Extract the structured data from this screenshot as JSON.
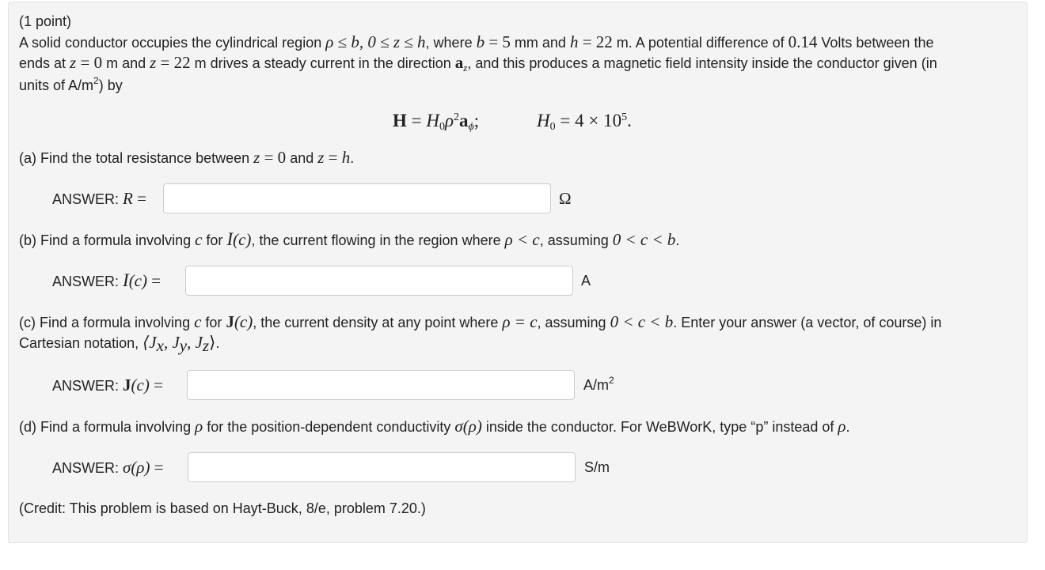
{
  "problem": {
    "points": "(1 point)",
    "intro": {
      "l1_a": "A solid conductor occupies the cylindrical region ",
      "l1_m1": "ρ ≤ b, 0 ≤ z ≤ h",
      "l1_b": ", where ",
      "l1_m2": "b",
      "l1_eq1": " = 5",
      "l1_c": " mm and ",
      "l1_m3": "h",
      "l1_eq2": " = 22",
      "l1_d": " m. A potential difference of ",
      "l1_m4": "0.14",
      "l1_e": " Volts between the",
      "l2_a": "ends at ",
      "l2_m1": "z",
      "l2_eq1": " = 0",
      "l2_b": " m and ",
      "l2_m2": "z",
      "l2_eq2": " = 22",
      "l2_c": " m drives a steady current in the direction ",
      "l2_vec": "a",
      "l2_vec_sub": "z",
      "l2_d": ", and this produces a magnetic field intensity inside the conductor given (in",
      "l3_a": "units of A/m",
      "l3_sup": "2",
      "l3_b": ") by"
    },
    "equation": {
      "H_bold": "H",
      "eq_sign": " = ",
      "H0": "H",
      "H0_sub": "0",
      "rho": "ρ",
      "rho_sup": "2",
      "a_bold": "a",
      "a_sub": "ϕ",
      "semicolon": ";",
      "H0b": "H",
      "H0b_sub": "0",
      "rhs": " = 4 × 10",
      "rhs_sup": "5",
      "period": "."
    },
    "parts": [
      {
        "id": "a",
        "question_text_1": "(a) Find the total resistance between ",
        "question_math_1": "z",
        "question_eq_1": " = 0",
        "question_text_2": " and ",
        "question_math_2": "z",
        "question_eq_2": " = ",
        "question_math_3": "h",
        "question_text_3": ".",
        "answer_label": "ANSWER: ",
        "answer_math": "R",
        "answer_eq": " =",
        "input_value": "",
        "unit": "Ω"
      },
      {
        "id": "b",
        "question_text_1": "(b) Find a formula involving ",
        "question_math_1": "c",
        "question_text_2": " for ",
        "question_math_2": "I",
        "question_math_2b": "(c)",
        "question_text_3": ", the current flowing in the region where ",
        "question_math_3": "ρ < c",
        "question_text_4": ", assuming ",
        "question_math_4": "0 < c < b",
        "question_text_5": ".",
        "answer_label": "ANSWER: ",
        "answer_math": "I",
        "answer_math_b": "(c)",
        "answer_eq": " =",
        "input_value": "",
        "unit": "A"
      },
      {
        "id": "c",
        "question_text_1": "(c) Find a formula involving ",
        "question_math_1": "c",
        "question_text_2": " for ",
        "question_math_2": "J",
        "question_math_2b": "(c)",
        "question_text_3": ", the current density at any point where ",
        "question_math_3": "ρ = c",
        "question_text_4": ", assuming ",
        "question_math_4": "0 < c < b",
        "question_text_5": ". Enter your answer (a vector, of course) in",
        "question_line2_a": "Cartesian notation, ",
        "question_line2_math": "⟨J",
        "question_line2_sx": "x",
        "question_line2_m2": ", J",
        "question_line2_sy": "y",
        "question_line2_m3": ", J",
        "question_line2_sz": "z",
        "question_line2_m4": "⟩",
        "question_line2_b": ".",
        "answer_label": "ANSWER: ",
        "answer_math": "J",
        "answer_math_b": "(c)",
        "answer_eq": " =",
        "input_value": "",
        "unit": "A/m",
        "unit_sup": "2"
      },
      {
        "id": "d",
        "question_text_1": "(d) Find a formula involving ",
        "question_math_1": "ρ",
        "question_text_2": " for the position-dependent conductivity ",
        "question_math_2": "σ(ρ)",
        "question_text_3": " inside the conductor. For WeBWorK, type “p” instead of ",
        "question_math_3": "ρ",
        "question_text_4": ".",
        "answer_label": "ANSWER: ",
        "answer_math": "σ(ρ)",
        "answer_eq": " =",
        "input_value": "",
        "unit": "S/m"
      }
    ],
    "credit": "(Credit: This problem is based on Hayt-Buck, 8/e, problem 7.20.)"
  }
}
